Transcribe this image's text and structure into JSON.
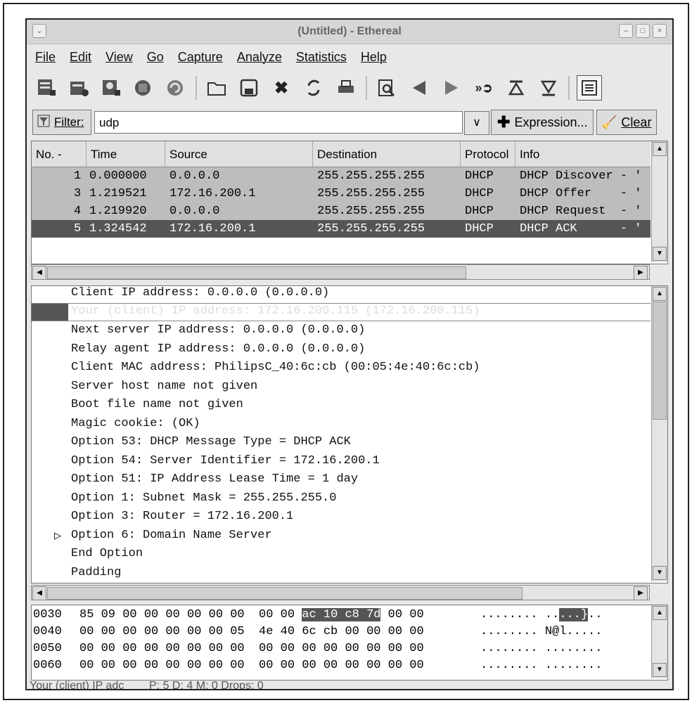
{
  "window": {
    "title": "(Untitled) - Ethereal"
  },
  "menu": [
    "File",
    "Edit",
    "View",
    "Go",
    "Capture",
    "Analyze",
    "Statistics",
    "Help"
  ],
  "toolbar": {
    "icons": [
      "capture-interfaces-icon",
      "capture-options-icon",
      "capture-start-icon",
      "capture-stop-icon",
      "capture-restart-icon",
      "open-icon",
      "save-icon",
      "close-icon",
      "reload-icon",
      "print-icon",
      "find-icon",
      "go-back-icon",
      "go-forward-icon",
      "go-to-packet-icon",
      "first-packet-icon",
      "last-packet-icon",
      "colorize-icon"
    ]
  },
  "filter": {
    "label": "Filter:",
    "value": "udp",
    "expression_label": "Expression...",
    "clear_label": "Clear"
  },
  "packet_list": {
    "columns": [
      "No. -",
      "Time",
      "Source",
      "Destination",
      "Protocol",
      "Info"
    ],
    "rows": [
      {
        "no": "1",
        "time": "0.000000",
        "source": "0.0.0.0",
        "destination": "255.255.255.255",
        "protocol": "DHCP",
        "info": "DHCP Discover - '"
      },
      {
        "no": "3",
        "time": "1.219521",
        "source": "172.16.200.1",
        "destination": "255.255.255.255",
        "protocol": "DHCP",
        "info": "DHCP Offer    - '"
      },
      {
        "no": "4",
        "time": "1.219920",
        "source": "0.0.0.0",
        "destination": "255.255.255.255",
        "protocol": "DHCP",
        "info": "DHCP Request  - '"
      },
      {
        "no": "5",
        "time": "1.324542",
        "source": "172.16.200.1",
        "destination": "255.255.255.255",
        "protocol": "DHCP",
        "info": "DHCP ACK      - '"
      }
    ]
  },
  "details": {
    "lines": [
      "Client IP address: 0.0.0.0 (0.0.0.0)",
      "Your (client) IP address: 172.16.200.115 (172.16.200.115)",
      "Next server IP address: 0.0.0.0 (0.0.0.0)",
      "Relay agent IP address: 0.0.0.0 (0.0.0.0)",
      "Client MAC address: PhilipsC_40:6c:cb (00:05:4e:40:6c:cb)",
      "Server host name not given",
      "Boot file name not given",
      "Magic cookie: (OK)",
      "Option 53: DHCP Message Type = DHCP ACK",
      "Option 54: Server Identifier = 172.16.200.1",
      "Option 51: IP Address Lease Time = 1 day",
      "Option 1: Subnet Mask = 255.255.255.0",
      "Option 3: Router = 172.16.200.1",
      "Option 6: Domain Name Server",
      "End Option",
      "Padding"
    ],
    "expander": "▷"
  },
  "hex": {
    "rows": [
      {
        "offset": "0030",
        "bytes_a": "85 09 00 00 00 00 00 00  00 00 ",
        "bytes_hl": "ac 10 c8 7d",
        "bytes_b": " 00 00",
        "ascii_a": "........ ..",
        "ascii_hl": "...}",
        "ascii_b": ".."
      },
      {
        "offset": "0040",
        "bytes_a": "00 00 00 00 00 00 00 05  4e 40 6c cb 00 00 00 00",
        "bytes_hl": "",
        "bytes_b": "",
        "ascii_a": "........ N@l.....",
        "ascii_hl": "",
        "ascii_b": ""
      },
      {
        "offset": "0050",
        "bytes_a": "00 00 00 00 00 00 00 00  00 00 00 00 00 00 00 00",
        "bytes_hl": "",
        "bytes_b": "",
        "ascii_a": "........ ........",
        "ascii_hl": "",
        "ascii_b": ""
      },
      {
        "offset": "0060",
        "bytes_a": "00 00 00 00 00 00 00 00  00 00 00 00 00 00 00 00",
        "bytes_hl": "",
        "bytes_b": "",
        "ascii_a": "........ ........",
        "ascii_hl": "",
        "ascii_b": ""
      }
    ]
  },
  "status": {
    "field": "Your (client) IP adc",
    "counts": "P: 5 D: 4 M: 0 Drops: 0"
  }
}
